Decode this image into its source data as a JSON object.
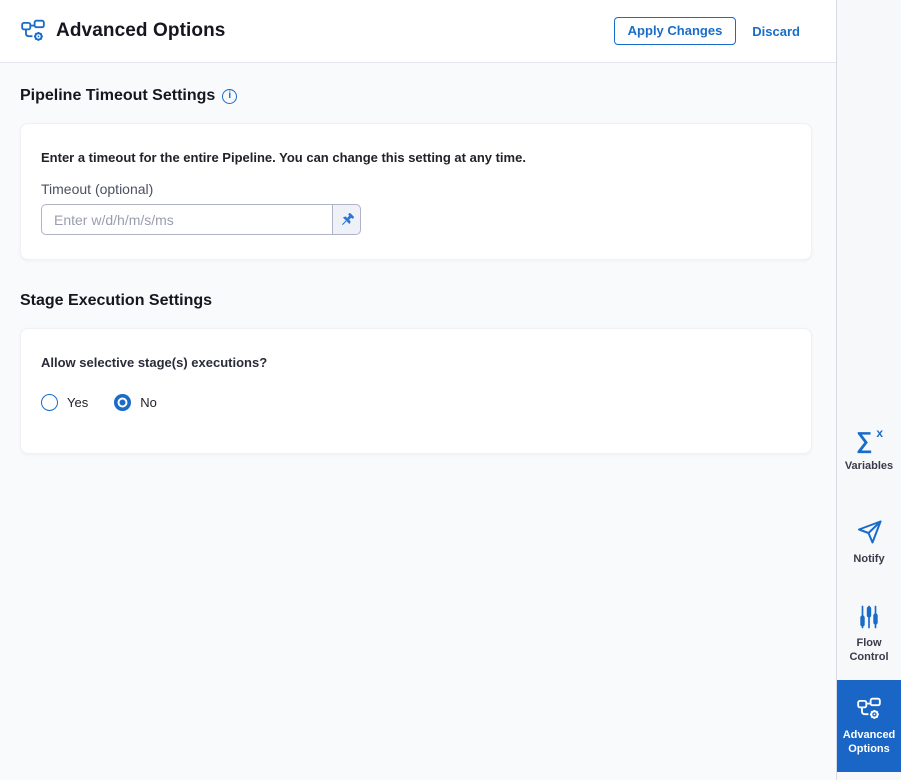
{
  "colors": {
    "accent": "#1a6cc9",
    "active_sidebar_bg": "#1a66c6",
    "header_bg": "#ffffff",
    "content_bg": "#f9fafc",
    "card_bg": "#ffffff"
  },
  "header": {
    "icon": "pipeline-gear-icon",
    "title": "Advanced Options",
    "apply_button": "Apply Changes",
    "discard_button": "Discard"
  },
  "pipeline_timeout": {
    "section_title": "Pipeline Timeout Settings",
    "info_icon": "info-icon",
    "info_glyph": "i",
    "description": "Enter a timeout for the entire Pipeline. You can change this setting at any time.",
    "timeout_label": "Timeout (optional)",
    "timeout_value": "",
    "timeout_placeholder": "Enter w/d/h/m/s/ms",
    "pin_icon": "thumbtack-icon"
  },
  "stage_execution": {
    "section_title": "Stage Execution Settings",
    "question": "Allow selective stage(s) executions?",
    "options": [
      {
        "label": "Yes",
        "selected": false
      },
      {
        "label": "No",
        "selected": true
      }
    ]
  },
  "sidebar": {
    "items": [
      {
        "label": "Variables",
        "icon": "sigma-x-icon",
        "active": false
      },
      {
        "label": "Notify",
        "icon": "paper-plane-icon",
        "active": false
      },
      {
        "label": "Flow Control",
        "icon": "sliders-icon",
        "active": false
      },
      {
        "label": "Advanced Options",
        "icon": "pipeline-gear-icon",
        "active": true
      }
    ],
    "sigma_glyph": "∑",
    "sigma_x_glyph": "x"
  }
}
